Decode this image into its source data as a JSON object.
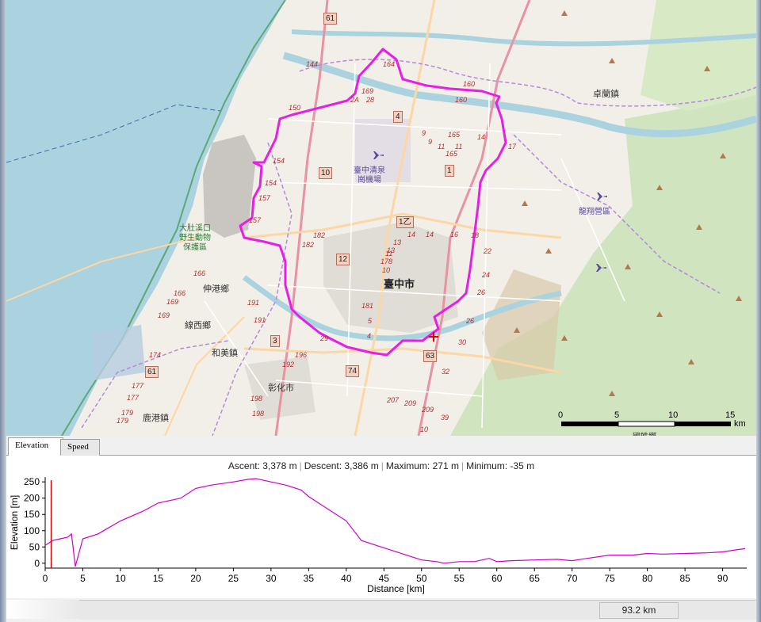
{
  "map": {
    "city_labels": [
      {
        "text": "臺中市",
        "class": "city"
      },
      {
        "text": "彰化市",
        "class": ""
      },
      {
        "text": "伸港鄉",
        "class": ""
      },
      {
        "text": "線西鄉",
        "class": ""
      },
      {
        "text": "和美鎮",
        "class": ""
      },
      {
        "text": "鹿港鎮",
        "class": ""
      },
      {
        "text": "卓蘭鎮",
        "class": ""
      },
      {
        "text": "國姓鄉",
        "class": ""
      }
    ],
    "airport_1": "臺中清泉\n崗機場",
    "airport_2": "龍翔營區",
    "park": "大肚溪口\n野生動物\n保護區",
    "shields": [
      "61",
      "4",
      "10",
      "1",
      "12",
      "1乙",
      "3",
      "74",
      "63",
      "61"
    ],
    "route_numbers": [
      "144",
      "164",
      "150",
      "160",
      "160",
      "169",
      "2A",
      "28",
      "154",
      "154",
      "157",
      "157",
      "165",
      "14",
      "17",
      "9",
      "9",
      "11",
      "11",
      "165",
      "14",
      "14",
      "16",
      "18",
      "13",
      "13",
      "11",
      "178",
      "182",
      "182",
      "166",
      "166",
      "169",
      "169",
      "191",
      "191",
      "181",
      "10",
      "5",
      "4",
      "22",
      "24",
      "26",
      "26",
      "30",
      "32",
      "29",
      "196",
      "192",
      "174",
      "177",
      "177",
      "179",
      "179",
      "198",
      "198",
      "207",
      "209",
      "209",
      "39",
      "10"
    ],
    "scale": {
      "ticks": [
        "0",
        "5",
        "10",
        "15"
      ],
      "unit": "km"
    }
  },
  "tabs": [
    {
      "label": "Elevation",
      "active": true
    },
    {
      "label": "Speed",
      "active": false
    }
  ],
  "stats": {
    "ascent": "Ascent: 3,378 m",
    "descent": "Descent: 3,386 m",
    "maximum": "Maximum: 271 m",
    "minimum": "Minimum: -35 m"
  },
  "status": {
    "distance": "93.2 km"
  },
  "chart_data": {
    "type": "line",
    "title": "",
    "xlabel": "Distance [km]",
    "ylabel": "Elevation [m]",
    "xlim": [
      0,
      93.2
    ],
    "ylim": [
      -15,
      265
    ],
    "x_ticks": [
      0,
      5,
      10,
      15,
      20,
      25,
      30,
      35,
      40,
      45,
      50,
      55,
      60,
      65,
      70,
      75,
      80,
      85,
      90
    ],
    "y_ticks": [
      0,
      50,
      100,
      150,
      200,
      250
    ],
    "series": [
      {
        "color": "#cc00cc",
        "x": [
          0,
          1,
          2,
          3,
          3.5,
          4,
          5,
          7,
          10,
          13,
          15,
          18,
          20,
          22,
          25,
          27,
          28,
          30,
          32,
          34,
          35,
          37,
          40,
          42,
          44,
          46,
          48,
          50,
          52,
          53,
          55,
          57,
          59,
          60,
          62,
          65,
          68,
          70,
          72,
          75,
          78,
          80,
          82,
          85,
          88,
          90,
          92,
          93
        ],
        "y": [
          55,
          70,
          75,
          80,
          90,
          -10,
          75,
          90,
          130,
          160,
          185,
          200,
          230,
          240,
          250,
          258,
          260,
          250,
          240,
          225,
          205,
          175,
          130,
          70,
          55,
          40,
          25,
          10,
          5,
          0,
          5,
          5,
          15,
          5,
          8,
          10,
          12,
          8,
          15,
          25,
          25,
          30,
          28,
          30,
          32,
          35,
          42,
          45
        ]
      },
      {
        "color": "#cc0000",
        "x": [
          0.8,
          0.8
        ],
        "y": [
          -15,
          255
        ]
      }
    ]
  }
}
